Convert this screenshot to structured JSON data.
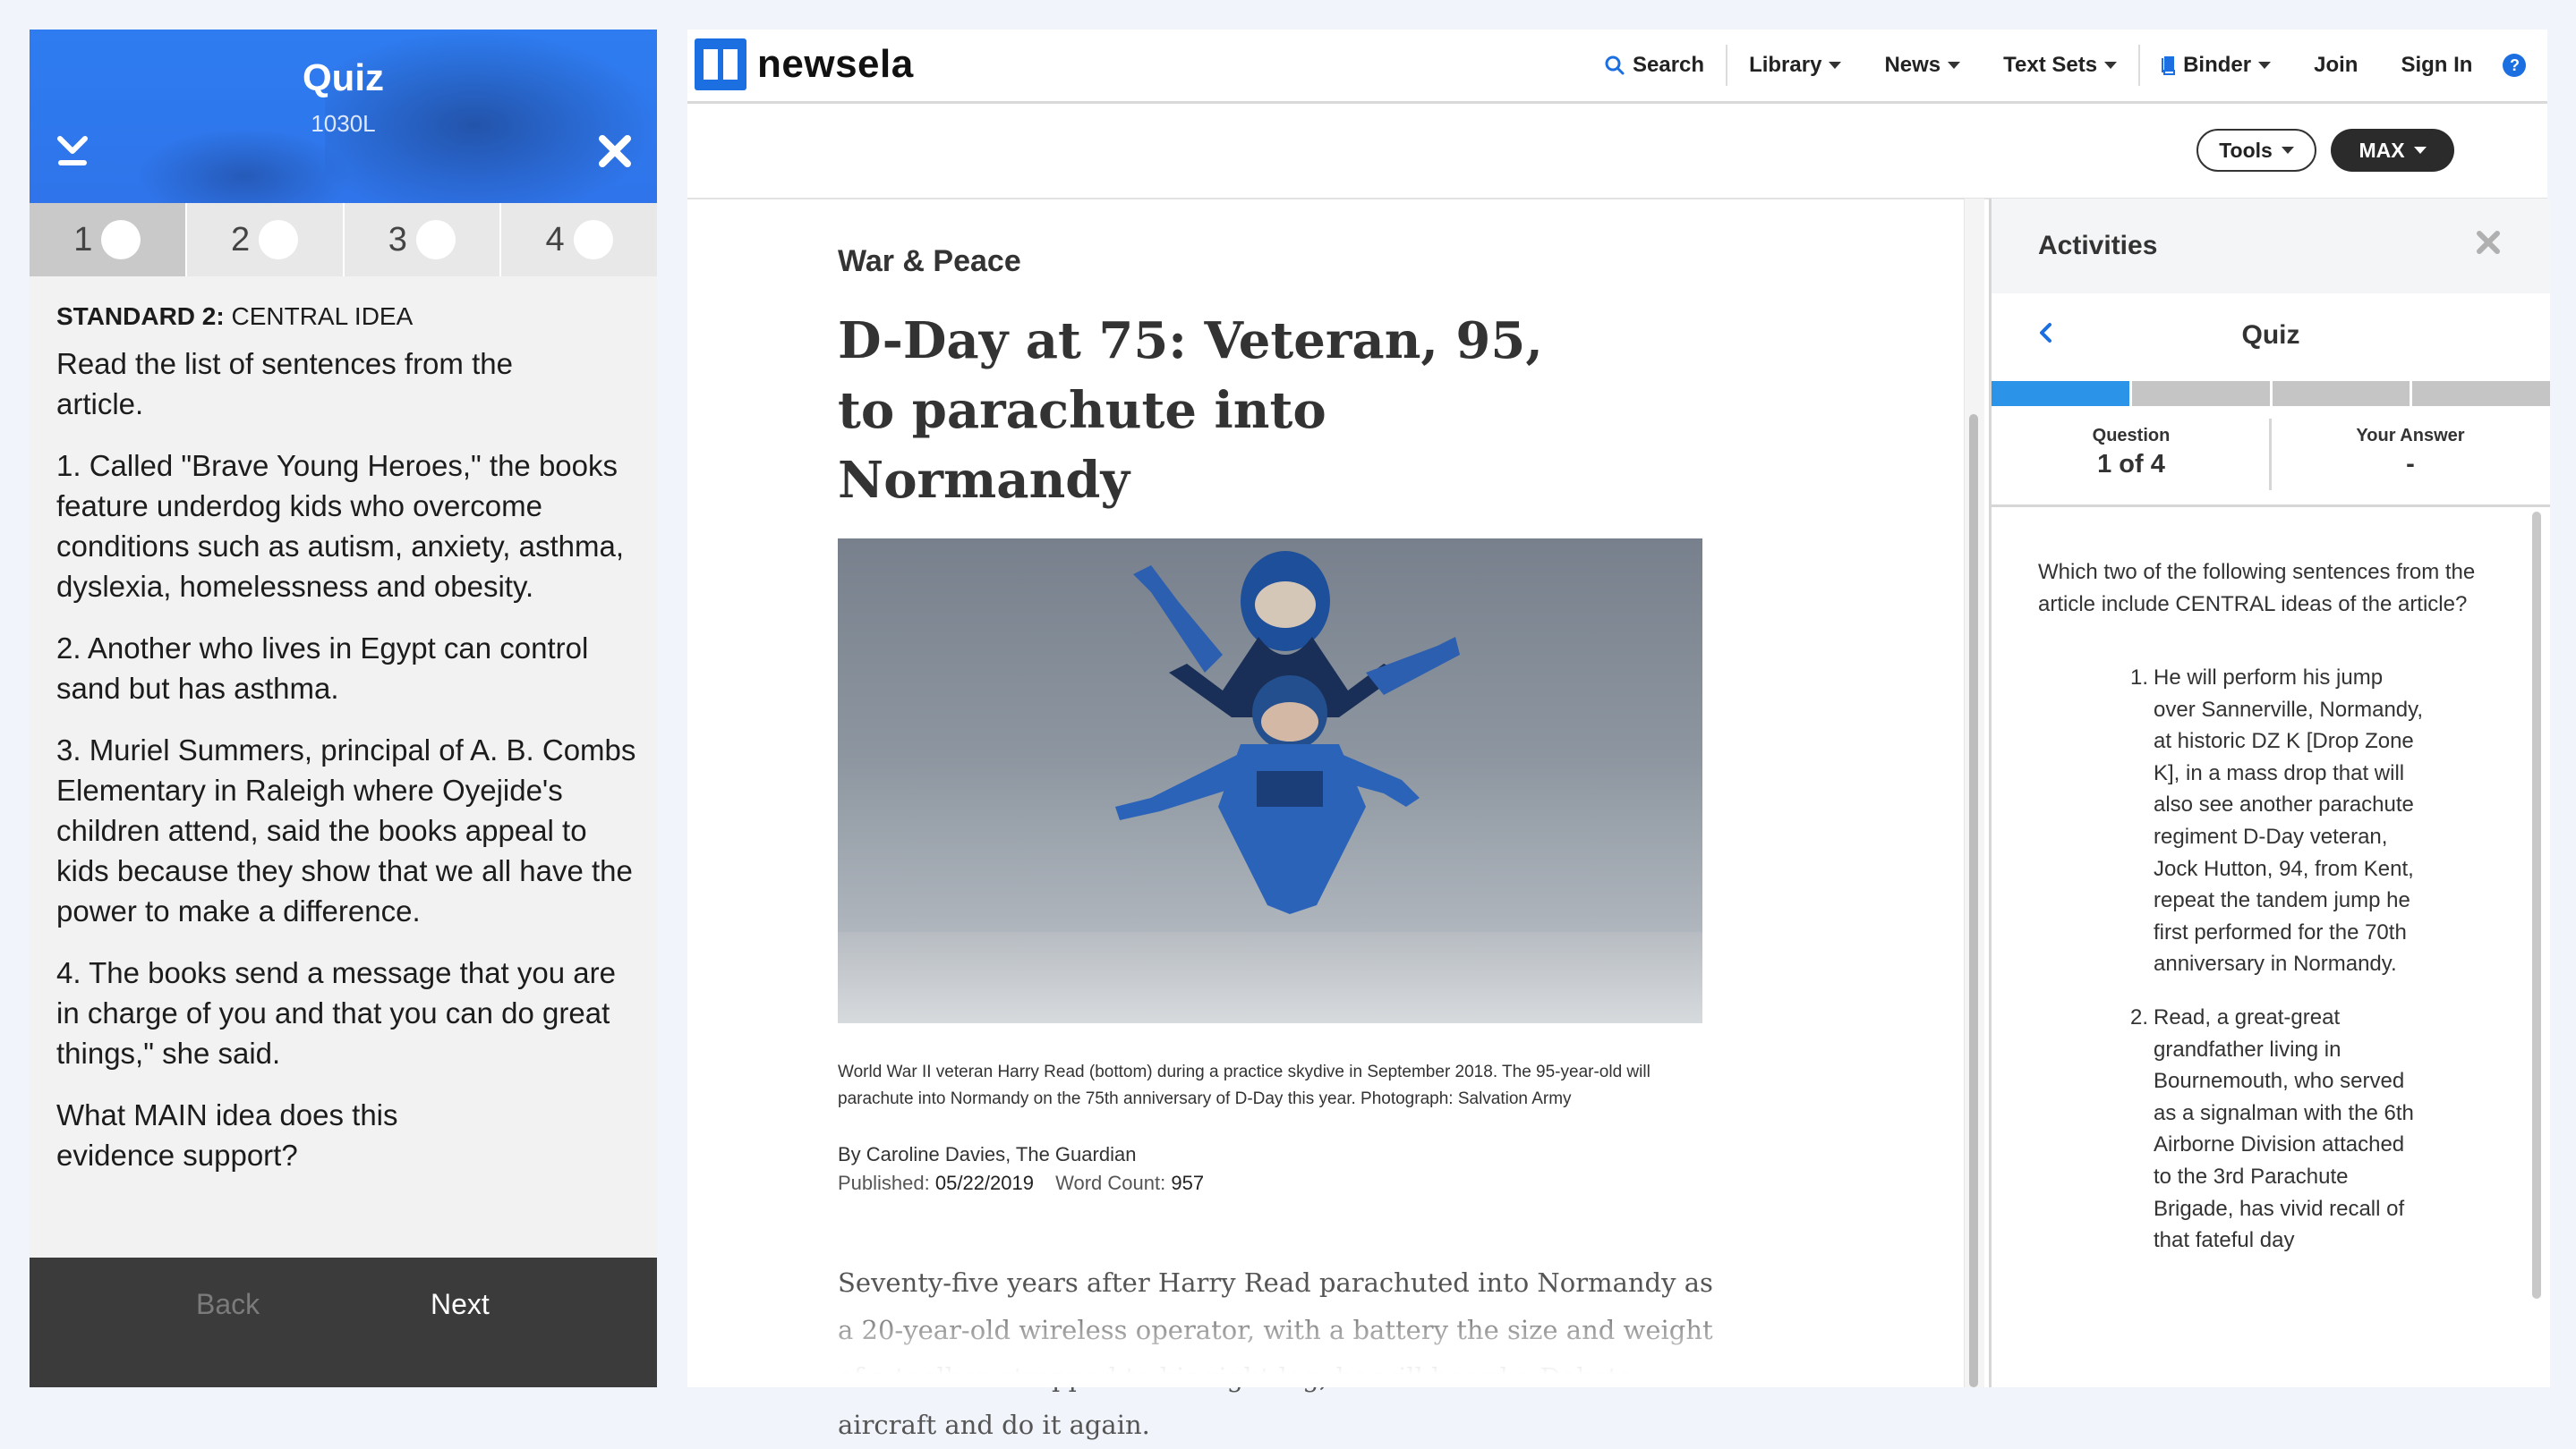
{
  "quiz_panel": {
    "title": "Quiz",
    "level": "1030L",
    "tabs": [
      {
        "label": "1",
        "active": true
      },
      {
        "label": "2",
        "active": false
      },
      {
        "label": "3",
        "active": false
      },
      {
        "label": "4",
        "active": false
      }
    ],
    "standard_label": "STANDARD 2:",
    "standard_name": "CENTRAL IDEA",
    "intro": "Read the list of sentences from the article.",
    "sentences": [
      "1. Called \"Brave Young Heroes,\" the books feature underdog kids who overcome conditions such as autism, anxiety, asthma, dyslexia, homelessness and obesity.",
      "2. Another who lives in Egypt can control sand but has asthma.",
      "3.  Muriel Summers, principal of A. B. Combs Elementary in Raleigh where Oyejide's children attend, said the books appeal to kids because they show that we all have the power to make a difference.",
      "4. The books send a message that you are in charge of you and that you can do great things,\" she said."
    ],
    "prompt": "What MAIN idea does this evidence support?",
    "back_label": "Back",
    "next_label": "Next",
    "icons": {
      "download": "download-icon",
      "close": "close-icon"
    }
  },
  "site": {
    "logo_text": "newsela",
    "nav": {
      "search": "Search",
      "library": "Library",
      "news": "News",
      "text_sets": "Text Sets",
      "binder": "Binder",
      "join": "Join",
      "sign_in": "Sign In",
      "help": "?"
    },
    "tools_label": "Tools",
    "max_label": "MAX",
    "brand_color": "#1c6fe0"
  },
  "article": {
    "kicker": "War & Peace",
    "headline": "D-Day at 75: Veteran, 95, to parachute into Normandy",
    "caption": "World War II veteran Harry Read (bottom) during a practice skydive in September 2018. The 95-year-old will parachute into Normandy on the 75th anniversary of D-Day this year. Photograph: Salvation Army",
    "byline": "By Caroline Davies, The Guardian",
    "published_label": "Published:",
    "published_value": "05/22/2019",
    "word_count_label": "Word Count:",
    "word_count_value": "957",
    "body": "Seventy-five years after Harry Read parachuted into Normandy as a 20-year-old wireless operator, with a battery the size and weight of a toolbox strapped to his right leg, he will board a Dakota aircraft and do it again."
  },
  "activities": {
    "title": "Activities",
    "quiz_title": "Quiz",
    "progress_current": 1,
    "progress_total": 4,
    "question_label": "Question",
    "question_value": "1 of 4",
    "answer_label": "Your Answer",
    "answer_value": "-",
    "question_text": "Which two of the following sentences from the article include CENTRAL ideas of the article?",
    "options": [
      {
        "num": "1.",
        "text": "He will perform his jump over Sannerville, Normandy, at historic DZ K [Drop Zone K], in a mass drop that will also see another parachute regiment D-Day veteran, Jock Hutton, 94, from Kent, repeat the tandem jump he first performed for the 70th anniversary in Normandy."
      },
      {
        "num": "2.",
        "text": "Read, a great-great grandfather living in Bournemouth, who served as a signalman with the 6th Airborne Division attached to the 3rd Parachute Brigade, has vivid recall of that fateful day"
      }
    ],
    "progress_color": "#2b93e8"
  }
}
